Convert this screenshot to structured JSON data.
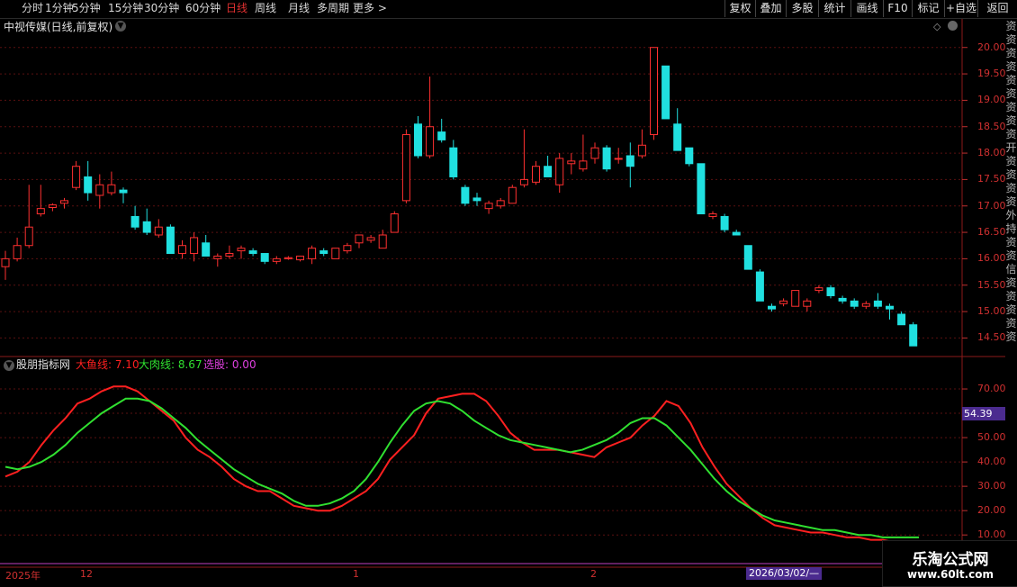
{
  "toolbar": {
    "periods": [
      {
        "label": "分时",
        "active": false
      },
      {
        "label": "1分钟",
        "active": false
      },
      {
        "label": "5分钟",
        "active": false
      },
      {
        "label": "15分钟",
        "active": false
      },
      {
        "label": "30分钟",
        "active": false
      },
      {
        "label": "60分钟",
        "active": false
      },
      {
        "label": "日线",
        "active": true
      },
      {
        "label": "周线",
        "active": false
      },
      {
        "label": "月线",
        "active": false
      },
      {
        "label": "多周期",
        "active": false
      },
      {
        "label": "更多 >",
        "active": false
      }
    ],
    "buttons": [
      "复权",
      "叠加",
      "多股",
      "统计",
      "画线",
      "F10",
      "标记",
      "+自选",
      "返回"
    ]
  },
  "kline_panel": {
    "title": "中视传媒(日线,前复权)",
    "price_labels": [
      "20.00",
      "19.50",
      "19.00",
      "18.50",
      "18.00",
      "17.50",
      "17.00",
      "16.50",
      "16.00",
      "15.50",
      "15.00",
      "14.50"
    ],
    "price_range": [
      14.2,
      20.2
    ]
  },
  "indicator_panel": {
    "name": "股朋指标网",
    "line1_label": "大鱼线: 7.10",
    "line2_label": "大肉线: 8.67",
    "select_label": "选股: 0.00",
    "labels": [
      "70.00",
      "60.00",
      "50.00",
      "40.00",
      "30.00",
      "20.00",
      "10.00"
    ],
    "current_value": "54.39",
    "range": [
      6,
      80
    ],
    "colors": {
      "line1": "#ff2020",
      "line2": "#30e030",
      "select": "#e040e0"
    }
  },
  "date_axis": {
    "labels": [
      "2025年",
      "12",
      "1",
      "2"
    ],
    "cursor_date": "2026/03/02/—"
  },
  "side_strip": [
    "资",
    "资",
    "资",
    "资",
    "资",
    "资",
    "资",
    "资",
    "资",
    "开",
    "资",
    "资",
    "资",
    "资",
    "外",
    "持",
    "资",
    "资",
    "信",
    "资",
    "资",
    "资",
    "资",
    "资"
  ],
  "brand": {
    "name": "乐淘公式网",
    "url": "www.60lt.com"
  },
  "chart_data": [
    {
      "type": "candlestick",
      "title": "中视传媒(日线,前复权)",
      "candles": [
        {
          "o": 15.85,
          "h": 16.15,
          "l": 15.6,
          "c": 16.0
        },
        {
          "o": 16.0,
          "h": 16.4,
          "l": 15.95,
          "c": 16.25
        },
        {
          "o": 16.25,
          "h": 17.4,
          "l": 16.2,
          "c": 16.6
        },
        {
          "o": 16.85,
          "h": 17.4,
          "l": 16.8,
          "c": 16.95
        },
        {
          "o": 16.97,
          "h": 17.05,
          "l": 16.9,
          "c": 17.02
        },
        {
          "o": 17.05,
          "h": 17.15,
          "l": 16.95,
          "c": 17.1
        },
        {
          "o": 17.35,
          "h": 17.85,
          "l": 17.3,
          "c": 17.75
        },
        {
          "o": 17.55,
          "h": 17.85,
          "l": 17.1,
          "c": 17.25
        },
        {
          "o": 17.2,
          "h": 17.6,
          "l": 16.95,
          "c": 17.4
        },
        {
          "o": 17.25,
          "h": 17.65,
          "l": 17.2,
          "c": 17.4
        },
        {
          "o": 17.3,
          "h": 17.35,
          "l": 17.05,
          "c": 17.25
        },
        {
          "o": 16.8,
          "h": 17.0,
          "l": 16.55,
          "c": 16.6
        },
        {
          "o": 16.7,
          "h": 16.95,
          "l": 16.45,
          "c": 16.5
        },
        {
          "o": 16.45,
          "h": 16.75,
          "l": 16.4,
          "c": 16.6
        },
        {
          "o": 16.6,
          "h": 16.65,
          "l": 16.1,
          "c": 16.1
        },
        {
          "o": 16.1,
          "h": 16.35,
          "l": 16.0,
          "c": 16.25
        },
        {
          "o": 16.1,
          "h": 16.5,
          "l": 15.95,
          "c": 16.4
        },
        {
          "o": 16.3,
          "h": 16.45,
          "l": 16.05,
          "c": 16.05
        },
        {
          "o": 16.0,
          "h": 16.1,
          "l": 15.85,
          "c": 16.05
        },
        {
          "o": 16.05,
          "h": 16.25,
          "l": 16.0,
          "c": 16.1
        },
        {
          "o": 16.15,
          "h": 16.25,
          "l": 16.0,
          "c": 16.2
        },
        {
          "o": 16.15,
          "h": 16.2,
          "l": 16.05,
          "c": 16.1
        },
        {
          "o": 16.1,
          "h": 16.1,
          "l": 15.9,
          "c": 15.95
        },
        {
          "o": 15.95,
          "h": 16.05,
          "l": 15.9,
          "c": 16.0
        },
        {
          "o": 16.0,
          "h": 16.05,
          "l": 15.98,
          "c": 16.02
        },
        {
          "o": 15.98,
          "h": 16.05,
          "l": 15.95,
          "c": 16.05
        },
        {
          "o": 16.0,
          "h": 16.25,
          "l": 15.9,
          "c": 16.2
        },
        {
          "o": 16.15,
          "h": 16.2,
          "l": 16.05,
          "c": 16.1
        },
        {
          "o": 16.0,
          "h": 16.2,
          "l": 16.0,
          "c": 16.2
        },
        {
          "o": 16.15,
          "h": 16.3,
          "l": 16.1,
          "c": 16.25
        },
        {
          "o": 16.3,
          "h": 16.45,
          "l": 16.2,
          "c": 16.45
        },
        {
          "o": 16.35,
          "h": 16.45,
          "l": 16.3,
          "c": 16.4
        },
        {
          "o": 16.2,
          "h": 16.55,
          "l": 16.2,
          "c": 16.45
        },
        {
          "o": 16.5,
          "h": 16.9,
          "l": 16.5,
          "c": 16.85
        },
        {
          "o": 17.1,
          "h": 18.45,
          "l": 17.05,
          "c": 18.35
        },
        {
          "o": 18.55,
          "h": 18.7,
          "l": 17.9,
          "c": 17.95
        },
        {
          "o": 17.95,
          "h": 19.45,
          "l": 17.9,
          "c": 18.5
        },
        {
          "o": 18.4,
          "h": 18.65,
          "l": 18.2,
          "c": 18.25
        },
        {
          "o": 18.1,
          "h": 18.25,
          "l": 17.5,
          "c": 17.55
        },
        {
          "o": 17.35,
          "h": 17.4,
          "l": 17.0,
          "c": 17.05
        },
        {
          "o": 17.15,
          "h": 17.25,
          "l": 17.0,
          "c": 17.1
        },
        {
          "o": 16.95,
          "h": 17.1,
          "l": 16.85,
          "c": 17.05
        },
        {
          "o": 17.0,
          "h": 17.15,
          "l": 16.95,
          "c": 17.1
        },
        {
          "o": 17.05,
          "h": 17.4,
          "l": 17.05,
          "c": 17.35
        },
        {
          "o": 17.4,
          "h": 18.45,
          "l": 17.35,
          "c": 17.5
        },
        {
          "o": 17.45,
          "h": 17.85,
          "l": 17.4,
          "c": 17.75
        },
        {
          "o": 17.75,
          "h": 17.95,
          "l": 17.6,
          "c": 17.55
        },
        {
          "o": 17.4,
          "h": 18.0,
          "l": 17.25,
          "c": 17.9
        },
        {
          "o": 17.8,
          "h": 18.0,
          "l": 17.6,
          "c": 17.85
        },
        {
          "o": 17.7,
          "h": 18.35,
          "l": 17.65,
          "c": 17.85
        },
        {
          "o": 17.9,
          "h": 18.2,
          "l": 17.8,
          "c": 18.1
        },
        {
          "o": 18.1,
          "h": 18.15,
          "l": 17.65,
          "c": 17.7
        },
        {
          "o": 17.9,
          "h": 18.1,
          "l": 17.8,
          "c": 17.9
        },
        {
          "o": 17.95,
          "h": 18.2,
          "l": 17.35,
          "c": 17.75
        },
        {
          "o": 17.95,
          "h": 18.45,
          "l": 17.9,
          "c": 18.15
        },
        {
          "o": 18.35,
          "h": 20.0,
          "l": 18.25,
          "c": 20.0
        },
        {
          "o": 19.65,
          "h": 19.65,
          "l": 18.65,
          "c": 18.65
        },
        {
          "o": 18.55,
          "h": 18.85,
          "l": 18.05,
          "c": 18.05
        },
        {
          "o": 18.1,
          "h": 18.1,
          "l": 17.75,
          "c": 17.8
        },
        {
          "o": 17.8,
          "h": 17.8,
          "l": 16.85,
          "c": 16.85
        },
        {
          "o": 16.8,
          "h": 16.9,
          "l": 16.75,
          "c": 16.85
        },
        {
          "o": 16.8,
          "h": 16.85,
          "l": 16.5,
          "c": 16.55
        },
        {
          "o": 16.5,
          "h": 16.55,
          "l": 16.45,
          "c": 16.45
        },
        {
          "o": 16.25,
          "h": 16.25,
          "l": 15.8,
          "c": 15.8
        },
        {
          "o": 15.75,
          "h": 15.8,
          "l": 15.2,
          "c": 15.2
        },
        {
          "o": 15.1,
          "h": 15.15,
          "l": 15.0,
          "c": 15.05
        },
        {
          "o": 15.15,
          "h": 15.25,
          "l": 15.1,
          "c": 15.2
        },
        {
          "o": 15.1,
          "h": 15.4,
          "l": 15.1,
          "c": 15.4
        },
        {
          "o": 15.1,
          "h": 15.25,
          "l": 15.0,
          "c": 15.2
        },
        {
          "o": 15.4,
          "h": 15.5,
          "l": 15.35,
          "c": 15.45
        },
        {
          "o": 15.45,
          "h": 15.5,
          "l": 15.25,
          "c": 15.3
        },
        {
          "o": 15.25,
          "h": 15.3,
          "l": 15.15,
          "c": 15.2
        },
        {
          "o": 15.2,
          "h": 15.25,
          "l": 15.05,
          "c": 15.1
        },
        {
          "o": 15.1,
          "h": 15.2,
          "l": 15.05,
          "c": 15.15
        },
        {
          "o": 15.2,
          "h": 15.35,
          "l": 15.05,
          "c": 15.1
        },
        {
          "o": 15.1,
          "h": 15.15,
          "l": 14.85,
          "c": 15.05
        },
        {
          "o": 14.95,
          "h": 15.0,
          "l": 14.75,
          "c": 14.75
        },
        {
          "o": 14.75,
          "h": 14.8,
          "l": 14.35,
          "c": 14.35
        }
      ]
    },
    {
      "type": "line",
      "title": "股朋指标网",
      "series": [
        {
          "name": "大鱼线",
          "color": "#ff2020",
          "values": [
            34,
            36,
            40,
            47,
            53,
            58,
            64,
            66,
            69,
            71,
            71,
            69,
            65,
            61,
            57,
            50,
            45,
            42,
            38,
            33,
            30,
            28,
            28,
            25,
            22,
            21,
            20,
            20,
            22,
            25,
            28,
            33,
            41,
            46,
            51,
            60,
            66,
            67,
            68,
            68,
            65,
            59,
            52,
            48,
            45,
            45,
            45,
            44,
            43,
            42,
            46,
            48,
            50,
            55,
            59,
            65,
            63,
            56,
            46,
            38,
            31,
            26,
            21,
            17,
            14,
            13,
            12,
            11,
            11,
            10,
            9,
            9,
            8,
            8,
            7,
            7,
            7
          ]
        },
        {
          "name": "大肉线",
          "color": "#30e030",
          "values": [
            38,
            37,
            38,
            40,
            43,
            47,
            52,
            56,
            60,
            63,
            66,
            66,
            65,
            62,
            58,
            54,
            49,
            45,
            41,
            37,
            34,
            31,
            29,
            27,
            24,
            22,
            22,
            23,
            25,
            28,
            33,
            40,
            48,
            55,
            61,
            64,
            65,
            64,
            61,
            57,
            54,
            51,
            49,
            48,
            47,
            46,
            45,
            44,
            45,
            47,
            49,
            52,
            56,
            58,
            58,
            55,
            50,
            45,
            39,
            33,
            28,
            24,
            21,
            18,
            16,
            15,
            14,
            13,
            12,
            12,
            11,
            10,
            10,
            9,
            9,
            9,
            9
          ]
        }
      ]
    }
  ]
}
